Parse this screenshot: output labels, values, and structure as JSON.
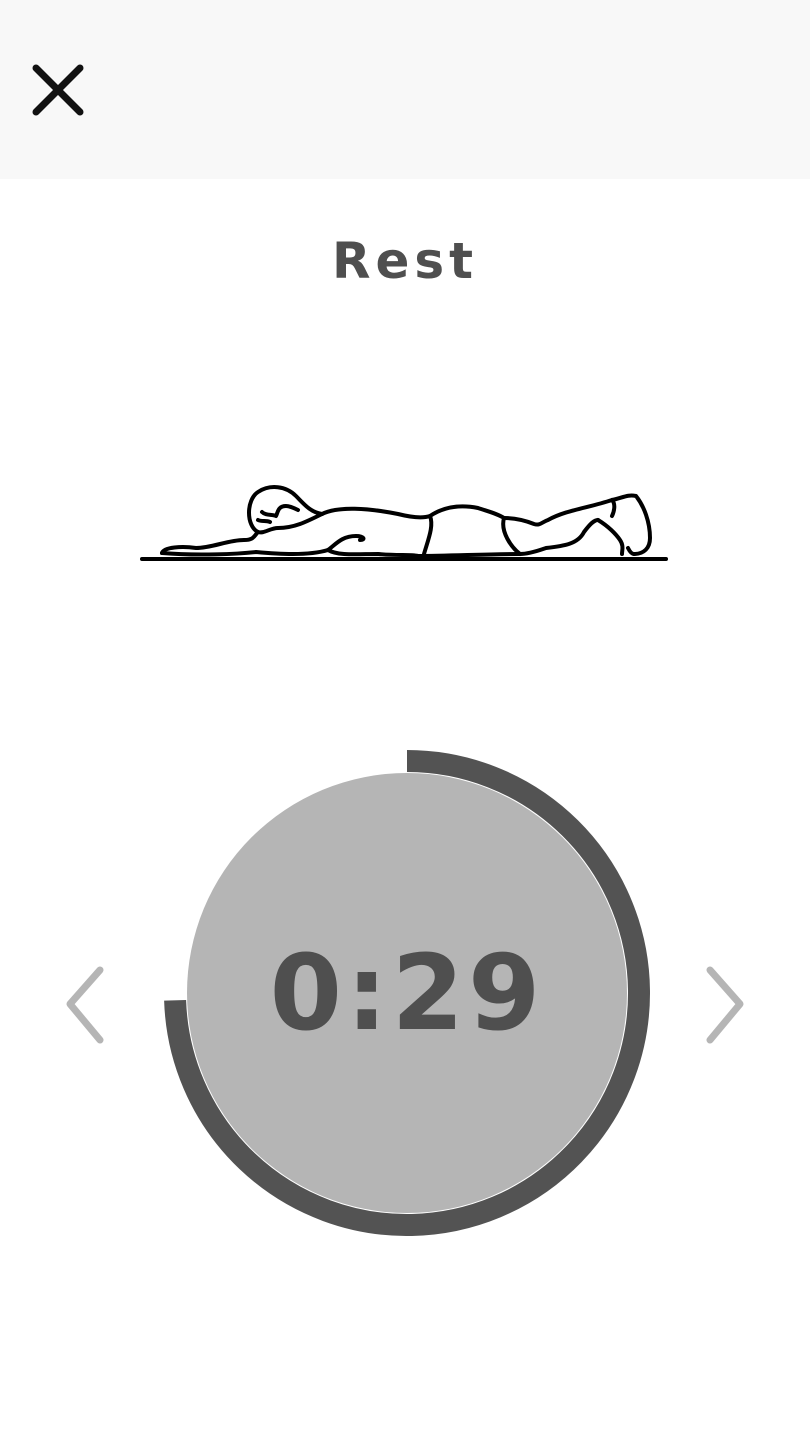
{
  "header": {
    "close_icon": "close-icon"
  },
  "exercise": {
    "title": "Rest",
    "illustration": "person-lying-prone-icon"
  },
  "timer": {
    "display": "0:29",
    "progress_fraction": 0.745,
    "ring_color": "#535353",
    "fill_color": "#b5b5b5"
  },
  "navigation": {
    "prev_icon": "chevron-left-icon",
    "next_icon": "chevron-right-icon",
    "arrow_color": "#b5b5b5"
  }
}
